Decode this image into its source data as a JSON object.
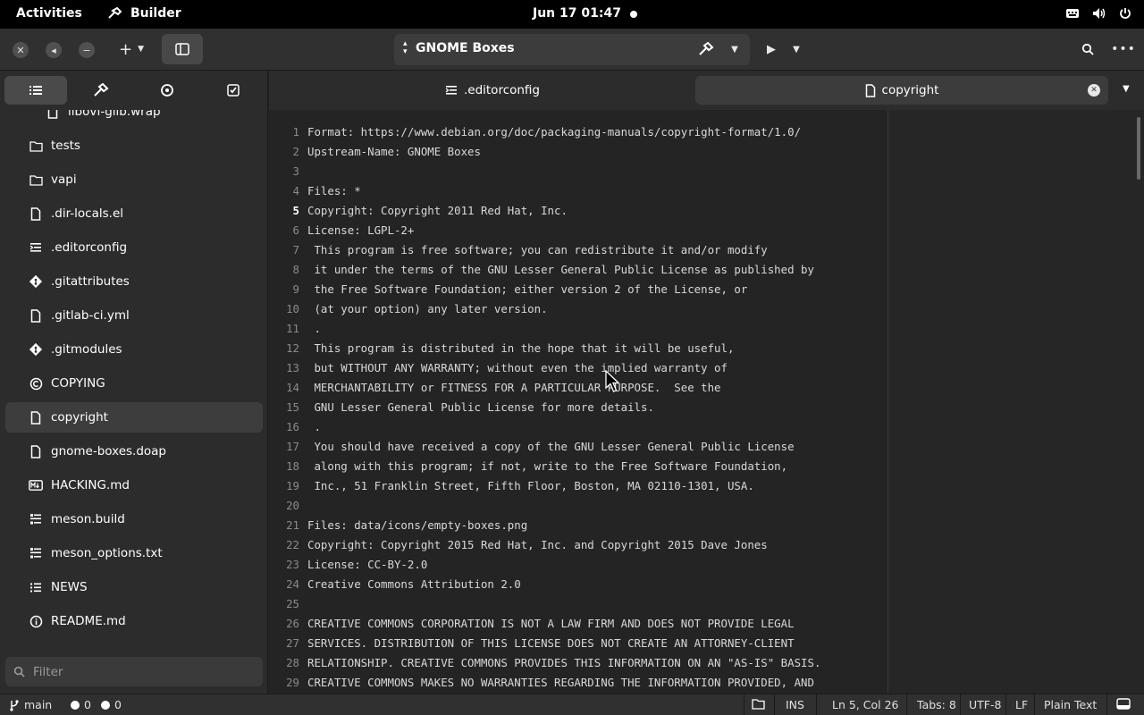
{
  "topbar": {
    "activities": "Activities",
    "app_name": "Builder",
    "clock": "Jun 17  01:47"
  },
  "header": {
    "project": "GNOME Boxes"
  },
  "sidebar": {
    "items": [
      {
        "label": "libovf-glib.wrap",
        "icon": "file-icon",
        "indent": true
      },
      {
        "label": "tests",
        "icon": "folder-icon"
      },
      {
        "label": "vapi",
        "icon": "folder-icon"
      },
      {
        "label": ".dir-locals.el",
        "icon": "file-icon"
      },
      {
        "label": ".editorconfig",
        "icon": "config-file-icon"
      },
      {
        "label": ".gitattributes",
        "icon": "git-icon"
      },
      {
        "label": ".gitlab-ci.yml",
        "icon": "file-icon"
      },
      {
        "label": ".gitmodules",
        "icon": "git-icon"
      },
      {
        "label": "COPYING",
        "icon": "copyright-icon"
      },
      {
        "label": "copyright",
        "icon": "file-icon",
        "selected": true
      },
      {
        "label": "gnome-boxes.doap",
        "icon": "file-icon"
      },
      {
        "label": "HACKING.md",
        "icon": "markdown-icon"
      },
      {
        "label": "meson.build",
        "icon": "build-file-icon"
      },
      {
        "label": "meson_options.txt",
        "icon": "build-file-icon"
      },
      {
        "label": "NEWS",
        "icon": "list-file-icon"
      },
      {
        "label": "README.md",
        "icon": "info-file-icon"
      }
    ],
    "filter_placeholder": "Filter"
  },
  "tabs": [
    {
      "label": ".editorconfig",
      "active": false
    },
    {
      "label": "copyright",
      "active": true
    }
  ],
  "editor": {
    "current_line": 5,
    "lines": [
      "Format: https://www.debian.org/doc/packaging-manuals/copyright-format/1.0/",
      "Upstream-Name: GNOME Boxes",
      "",
      "Files: *",
      "Copyright: Copyright 2011 Red Hat, Inc.",
      "License: LGPL-2+",
      " This program is free software; you can redistribute it and/or modify",
      " it under the terms of the GNU Lesser General Public License as published by",
      " the Free Software Foundation; either version 2 of the License, or",
      " (at your option) any later version.",
      " .",
      " This program is distributed in the hope that it will be useful,",
      " but WITHOUT ANY WARRANTY; without even the implied warranty of",
      " MERCHANTABILITY or FITNESS FOR A PARTICULAR PURPOSE.  See the",
      " GNU Lesser General Public License for more details.",
      " .",
      " You should have received a copy of the GNU Lesser General Public License",
      " along with this program; if not, write to the Free Software Foundation,",
      " Inc., 51 Franklin Street, Fifth Floor, Boston, MA 02110-1301, USA.",
      "",
      "Files: data/icons/empty-boxes.png",
      "Copyright: Copyright 2015 Red Hat, Inc. and Copyright 2015 Dave Jones",
      "License: CC-BY-2.0",
      "Creative Commons Attribution 2.0",
      "",
      "CREATIVE COMMONS CORPORATION IS NOT A LAW FIRM AND DOES NOT PROVIDE LEGAL",
      "SERVICES. DISTRIBUTION OF THIS LICENSE DOES NOT CREATE AN ATTORNEY-CLIENT",
      "RELATIONSHIP. CREATIVE COMMONS PROVIDES THIS INFORMATION ON AN \"AS-IS\" BASIS.",
      "CREATIVE COMMONS MAKES NO WARRANTIES REGARDING THE INFORMATION PROVIDED, AND"
    ]
  },
  "status": {
    "branch": "main",
    "errors": "0",
    "warnings": "0",
    "mode": "INS",
    "position": "Ln 5, Col 26",
    "tabs": "Tabs: 8",
    "encoding": "UTF-8",
    "line_ending": "LF",
    "language": "Plain Text"
  }
}
